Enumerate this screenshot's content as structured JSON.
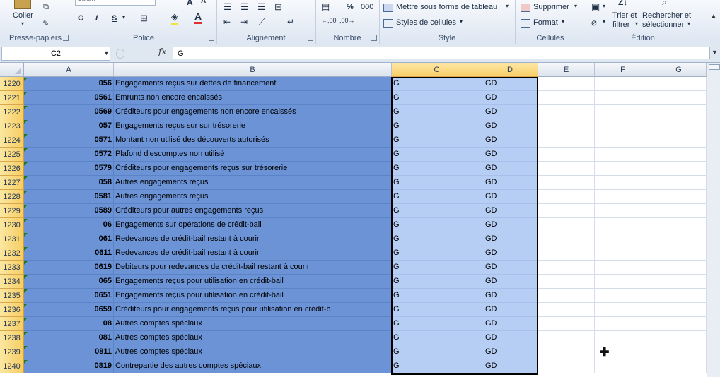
{
  "ribbon": {
    "clipboard": {
      "paste_label": "Coller",
      "group_label": "Presse-papiers"
    },
    "font": {
      "font_name": "Calibri",
      "bold": "G",
      "italic": "I",
      "underline": "S",
      "group_label": "Police"
    },
    "alignment": {
      "group_label": "Alignement"
    },
    "number": {
      "percent": "%",
      "thousands": "000",
      "dec_inc": ",0 ,00",
      "dec_dec": ",00 ,0",
      "group_label": "Nombre"
    },
    "style": {
      "format_table": "Mettre sous forme de tableau",
      "cell_styles": "Styles de cellules",
      "group_label": "Style"
    },
    "cells": {
      "delete": "Supprimer",
      "format": "Format",
      "group_label": "Cellules"
    },
    "editing": {
      "sort_filter_1": "Trier et",
      "sort_filter_2": "filtrer",
      "find_select_1": "Rechercher et",
      "find_select_2": "sélectionner",
      "group_label": "Édition"
    }
  },
  "formula_bar": {
    "name_box": "C2",
    "fx": "fx",
    "value": "G"
  },
  "columns": [
    "A",
    "B",
    "C",
    "D",
    "E",
    "F",
    "G"
  ],
  "selected_columns": [
    "C",
    "D"
  ],
  "rows": [
    {
      "num": "1220",
      "a": "056",
      "b": "Engagements reçus sur dettes de financement",
      "c": "G",
      "d": "GD"
    },
    {
      "num": "1221",
      "a": "0561",
      "b": "Emrunts non encore encaissés",
      "c": "G",
      "d": "GD"
    },
    {
      "num": "1222",
      "a": "0569",
      "b": "Créditeurs pour engagements non encore encaissés",
      "c": "G",
      "d": "GD"
    },
    {
      "num": "1223",
      "a": "057",
      "b": "Engagements reçus sur sur trésorerie",
      "c": "G",
      "d": "GD"
    },
    {
      "num": "1224",
      "a": "0571",
      "b": "Montant non utilisé des découverts autorisés",
      "c": "G",
      "d": "GD"
    },
    {
      "num": "1225",
      "a": "0572",
      "b": "Plafond d'escomptes non utilisé",
      "c": "G",
      "d": "GD"
    },
    {
      "num": "1226",
      "a": "0579",
      "b": "Créditeurs pour engagements reçus sur trésorerie",
      "c": "G",
      "d": "GD"
    },
    {
      "num": "1227",
      "a": "058",
      "b": "Autres engagements reçus",
      "c": "G",
      "d": "GD"
    },
    {
      "num": "1228",
      "a": "0581",
      "b": "Autres engagements reçus",
      "c": "G",
      "d": "GD"
    },
    {
      "num": "1229",
      "a": "0589",
      "b": "Créditeurs pour autres engagements reçus",
      "c": "G",
      "d": "GD"
    },
    {
      "num": "1230",
      "a": "06",
      "b": "Engagements sur opérations de crédit-bail",
      "c": "G",
      "d": "GD"
    },
    {
      "num": "1231",
      "a": "061",
      "b": "Redevances de crédit-bail restant à courir",
      "c": "G",
      "d": "GD"
    },
    {
      "num": "1232",
      "a": "0611",
      "b": "Redevances de crédit-bail restant à courir",
      "c": "G",
      "d": "GD"
    },
    {
      "num": "1233",
      "a": "0619",
      "b": "Debiteurs pour redevances de crédit-bail restant à courir",
      "c": "G",
      "d": "GD"
    },
    {
      "num": "1234",
      "a": "065",
      "b": "Engagements reçus pour utilisation en crédit-bail",
      "c": "G",
      "d": "GD"
    },
    {
      "num": "1235",
      "a": "0651",
      "b": "Engagements reçus pour utilisation en crédit-bail",
      "c": "G",
      "d": "GD"
    },
    {
      "num": "1236",
      "a": "0659",
      "b": "Créditeurs pour engagements reçus pour utilisation en crédit-b",
      "c": "G",
      "d": "GD"
    },
    {
      "num": "1237",
      "a": "08",
      "b": "Autres comptes spéciaux",
      "c": "G",
      "d": "GD"
    },
    {
      "num": "1238",
      "a": "081",
      "b": "Autres comptes spéciaux",
      "c": "G",
      "d": "GD"
    },
    {
      "num": "1239",
      "a": "0811",
      "b": "Autres comptes spéciaux",
      "c": "G",
      "d": "GD"
    },
    {
      "num": "1240",
      "a": "0819",
      "b": "Contrepartie des autres comptes spéciaux",
      "c": "G",
      "d": "GD"
    }
  ],
  "colors": {
    "selection_dark": "#6b93d6",
    "selection_light": "#b7cef4",
    "header_selected": "#f9cf6a"
  }
}
